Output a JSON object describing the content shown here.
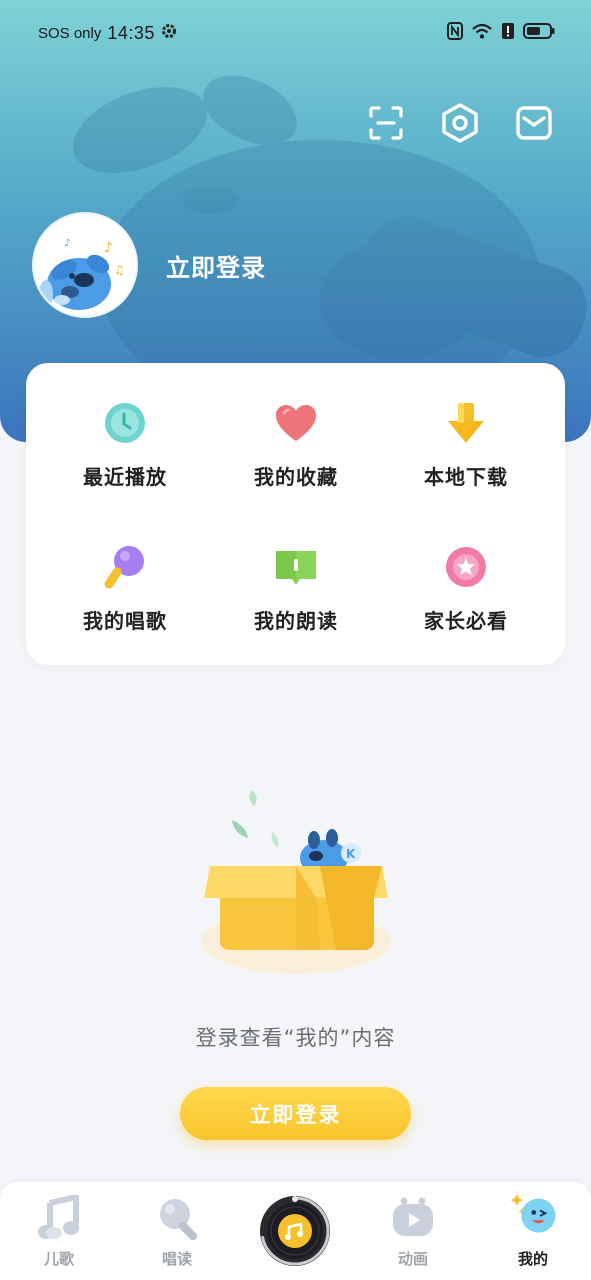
{
  "status_bar": {
    "carrier": "SOS only",
    "time": "14:35"
  },
  "header": {
    "login_text": "立即登录",
    "icons": [
      "scan-icon",
      "settings-hex-icon",
      "mail-icon"
    ]
  },
  "menu": {
    "items": [
      {
        "label": "最近播放",
        "icon": "clock-icon",
        "color": "#6fd4cf"
      },
      {
        "label": "我的收藏",
        "icon": "heart-icon",
        "color": "#f0757a"
      },
      {
        "label": "本地下载",
        "icon": "download-arrow-icon",
        "color": "#f5c02e"
      },
      {
        "label": "我的唱歌",
        "icon": "microphone-icon",
        "color": "#a77ef0"
      },
      {
        "label": "我的朗读",
        "icon": "book-icon",
        "color": "#8bd45b"
      },
      {
        "label": "家长必看",
        "icon": "star-badge-icon",
        "color": "#f07aa8"
      }
    ]
  },
  "empty_state": {
    "message": "登录查看“我的”内容",
    "button_label": "立即登录"
  },
  "bottom_nav": {
    "items": [
      {
        "label": "儿歌",
        "icon": "music-note-icon",
        "active": false
      },
      {
        "label": "唱读",
        "icon": "mic-icon",
        "active": false
      },
      {
        "label": "",
        "icon": "vinyl-disc-icon",
        "active": false
      },
      {
        "label": "动画",
        "icon": "tv-play-icon",
        "active": false
      },
      {
        "label": "我的",
        "icon": "mascot-face-icon",
        "active": true
      }
    ]
  },
  "colors": {
    "header_top": "#7fd2d6",
    "header_bottom": "#3b74bd",
    "button_yellow": "#f7c52a",
    "background": "#f4f5f8"
  }
}
